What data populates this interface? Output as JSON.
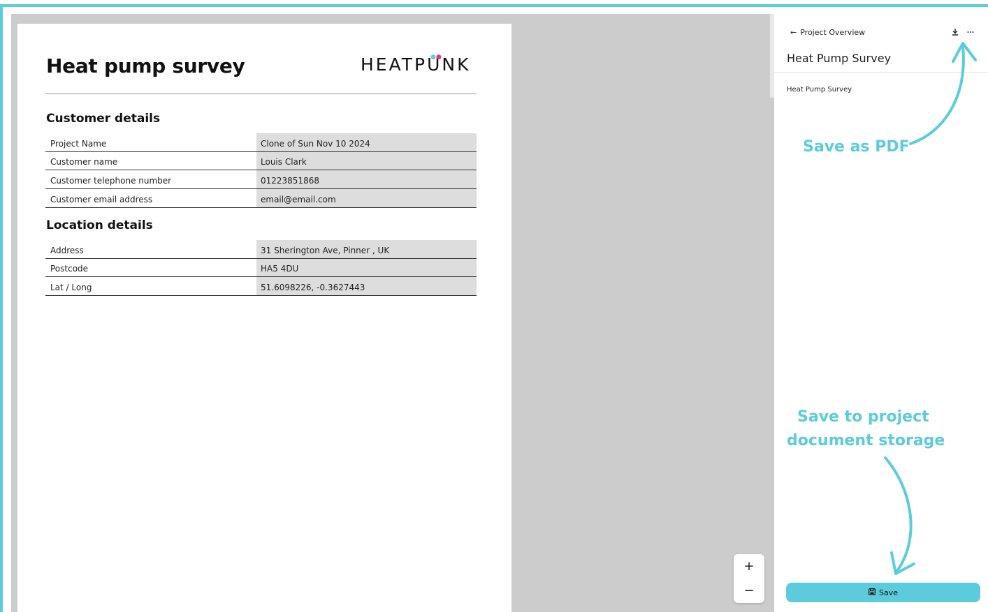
{
  "document": {
    "title": "Heat pump survey",
    "logo": {
      "before": "HEATP",
      "u": "U",
      "after": "NK"
    },
    "sections": [
      {
        "heading": "Customer details",
        "rows": [
          {
            "label": "Project Name",
            "value": "Clone of Sun Nov 10 2024"
          },
          {
            "label": "Customer name",
            "value": "Louis Clark"
          },
          {
            "label": "Customer telephone number",
            "value": "01223851868"
          },
          {
            "label": "Customer email address",
            "value": "email@email.com"
          }
        ]
      },
      {
        "heading": "Location details",
        "rows": [
          {
            "label": "Address",
            "value": "31 Sherington Ave, Pinner , UK"
          },
          {
            "label": "Postcode",
            "value": "HA5 4DU"
          },
          {
            "label": "Lat / Long",
            "value": "51.6098226, -0.3627443"
          }
        ]
      }
    ]
  },
  "zoom": {
    "in": "+",
    "out": "−"
  },
  "panel": {
    "back_label": "Project Overview",
    "back_icon": "arrow-left-icon",
    "download_icon": "download-icon",
    "more_icon": "more-icon",
    "title": "Heat Pump Survey",
    "doc_item": "Heat Pump Survey",
    "save_label": "Save",
    "save_icon": "floppy-disk-icon"
  },
  "annotations": {
    "pdf": "Save as PDF",
    "storage_line1": "Save to project",
    "storage_line2": "document storage"
  },
  "colors": {
    "accent": "#5ccbdb",
    "logo_dot_pink": "#e8347e",
    "canvas": "#cccccc",
    "cell": "#dddddd"
  }
}
